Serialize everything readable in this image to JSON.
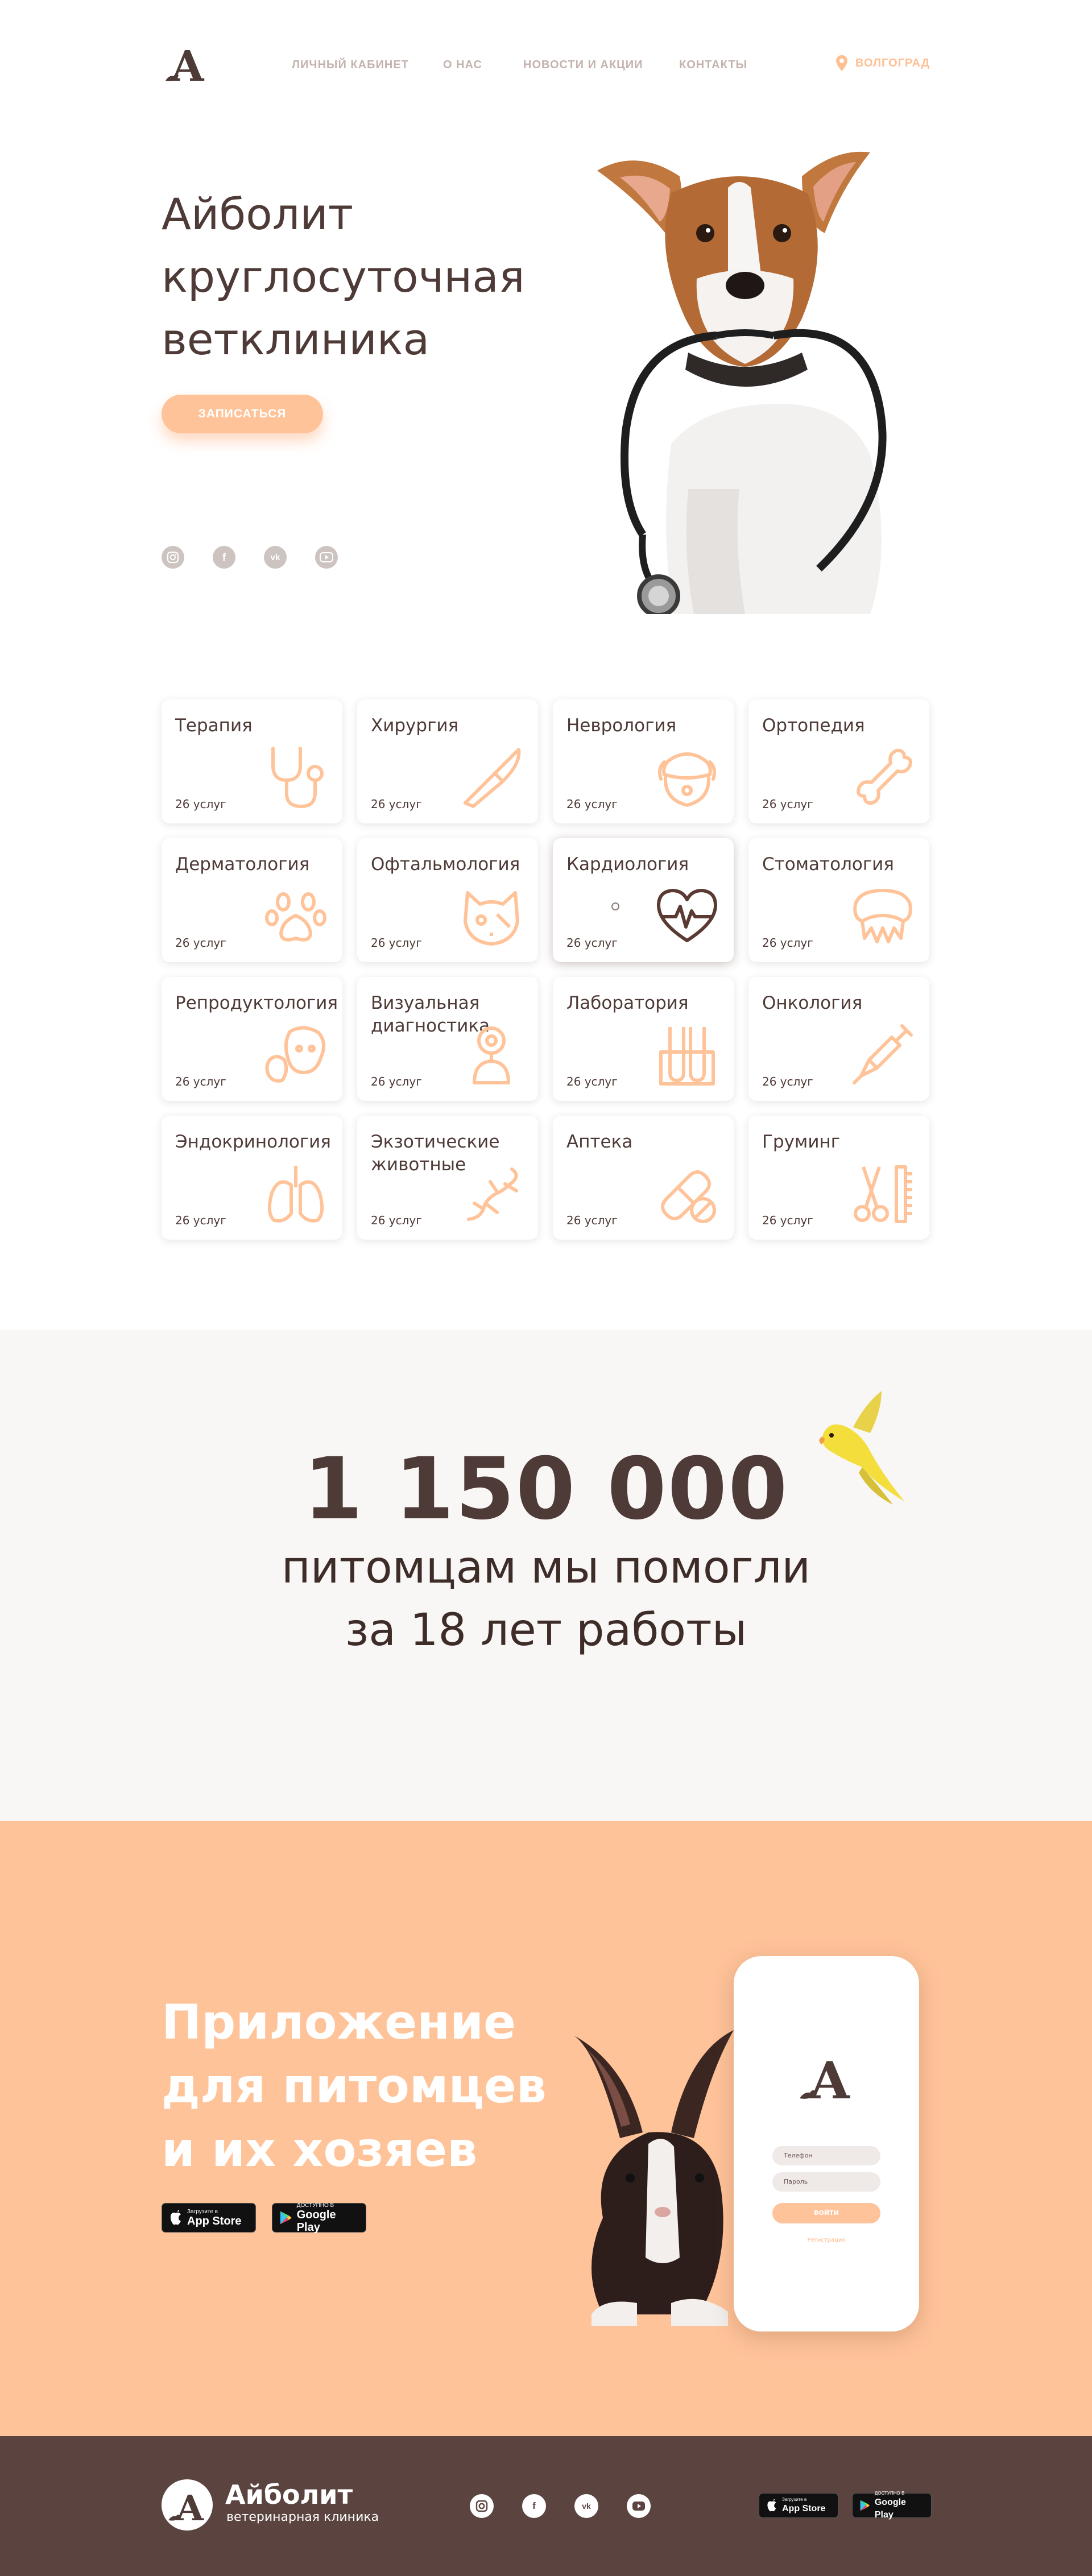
{
  "header": {
    "logo_letter": "A",
    "nav": [
      "ЛИЧНЫЙ КАБИНЕТ",
      "О НАС",
      "НОВОСТИ И АКЦИИ",
      "КОНТАКТЫ"
    ],
    "city": "ВОЛГОГРАД"
  },
  "hero": {
    "title_lines": [
      "Айболит",
      "круглосуточная",
      "ветклиника"
    ],
    "cta": "ЗАПИСАТЬСЯ",
    "social": [
      "instagram-icon",
      "facebook-icon",
      "vk-icon",
      "youtube-icon"
    ]
  },
  "services": [
    {
      "name": "Терапия",
      "count": "26 услуг",
      "icon": "stethoscope-icon"
    },
    {
      "name": "Хирургия",
      "count": "26 услуг",
      "icon": "scalpel-icon"
    },
    {
      "name": "Неврология",
      "count": "26 услуг",
      "icon": "dog-brain-icon"
    },
    {
      "name": "Ортопедия",
      "count": "26 услуг",
      "icon": "bone-icon"
    },
    {
      "name": "Дерматология",
      "count": "26 услуг",
      "icon": "paw-icon"
    },
    {
      "name": "Офтальмология",
      "count": "26 услуг",
      "icon": "cat-eye-icon"
    },
    {
      "name": "Кардиология",
      "count": "26 услуг",
      "icon": "heart-pulse-icon"
    },
    {
      "name": "Стоматология",
      "count": "26 услуг",
      "icon": "teeth-icon"
    },
    {
      "name": "Репродуктология",
      "count": "26 услуг",
      "icon": "puppies-icon"
    },
    {
      "name": "Визуальная диагностика",
      "count": "26 услуг",
      "icon": "microscope-icon"
    },
    {
      "name": "Лаборатория",
      "count": "26 услуг",
      "icon": "test-tubes-icon"
    },
    {
      "name": "Онкология",
      "count": "26 услуг",
      "icon": "syringe-icon"
    },
    {
      "name": "Эндокринология",
      "count": "26 услуг",
      "icon": "lungs-icon"
    },
    {
      "name": "Экзотические животные",
      "count": "26 услуг",
      "icon": "lizard-icon"
    },
    {
      "name": "Аптека",
      "count": "26 услуг",
      "icon": "pills-icon"
    },
    {
      "name": "Груминг",
      "count": "26 услуг",
      "icon": "scissors-comb-icon"
    }
  ],
  "stats": {
    "number": "1 150 000",
    "line1": "питомцам мы помогли",
    "line2": "за 18 лет работы"
  },
  "app": {
    "title_lines": [
      "Приложение",
      "для питомцев",
      "и их хозяев"
    ],
    "appstore_small": "Загрузите в",
    "appstore_large": "App Store",
    "googleplay_small": "ДОСТУПНО В",
    "googleplay_large": "Google Play",
    "phone": {
      "phone_placeholder": "Телефон",
      "password_placeholder": "Пароль",
      "login": "ВОЙТИ",
      "register": "Регистрация"
    }
  },
  "footer": {
    "title": "Айболит",
    "subtitle": "ветеринарная клиника"
  },
  "colors": {
    "accent": "#ffc39a",
    "brown": "#4e3a36",
    "footer": "#5b4440",
    "stats_bg": "#f9f7f6"
  }
}
